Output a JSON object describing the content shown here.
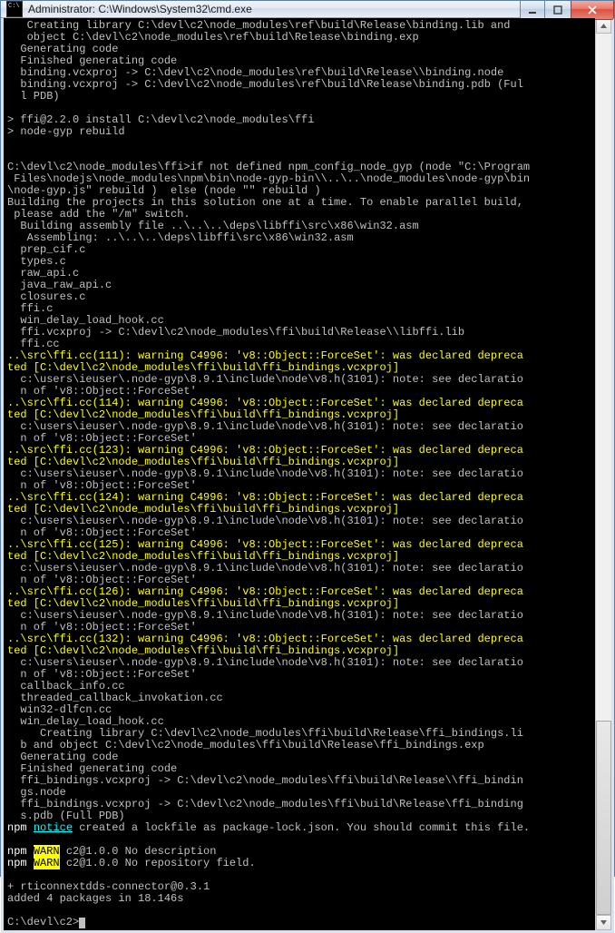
{
  "window": {
    "title": "Administrator: C:\\Windows\\System32\\cmd.exe"
  },
  "scrollbar": {
    "thumb_top_pct": 78,
    "thumb_height_pct": 22
  },
  "lines": [
    {
      "cls": "w",
      "t": "   Creating library C:\\devl\\c2\\node_modules\\ref\\build\\Release\\binding.lib and"
    },
    {
      "cls": "w",
      "t": "   object C:\\devl\\c2\\node_modules\\ref\\build\\Release\\binding.exp"
    },
    {
      "cls": "w",
      "t": "  Generating code"
    },
    {
      "cls": "w",
      "t": "  Finished generating code"
    },
    {
      "cls": "w",
      "t": "  binding.vcxproj -> C:\\devl\\c2\\node_modules\\ref\\build\\Release\\\\binding.node"
    },
    {
      "cls": "w",
      "t": "  binding.vcxproj -> C:\\devl\\c2\\node_modules\\ref\\build\\Release\\binding.pdb (Ful"
    },
    {
      "cls": "w",
      "t": "  l PDB)"
    },
    {
      "cls": "w",
      "t": ""
    },
    {
      "cls": "w",
      "t": "> ffi@2.2.0 install C:\\devl\\c2\\node_modules\\ffi"
    },
    {
      "cls": "w",
      "t": "> node-gyp rebuild"
    },
    {
      "cls": "w",
      "t": ""
    },
    {
      "cls": "w",
      "t": ""
    },
    {
      "cls": "w",
      "t": "C:\\devl\\c2\\node_modules\\ffi>if not defined npm_config_node_gyp (node \"C:\\Program"
    },
    {
      "cls": "w",
      "t": " Files\\nodejs\\node_modules\\npm\\bin\\node-gyp-bin\\\\..\\..\\node_modules\\node-gyp\\bin"
    },
    {
      "cls": "w",
      "t": "\\node-gyp.js\" rebuild )  else (node \"\" rebuild )"
    },
    {
      "cls": "w",
      "t": "Building the projects in this solution one at a time. To enable parallel build,"
    },
    {
      "cls": "w",
      "t": " please add the \"/m\" switch."
    },
    {
      "cls": "w",
      "t": "  Building assembly file ..\\..\\..\\deps\\libffi\\src\\x86\\win32.asm"
    },
    {
      "cls": "w",
      "t": "   Assembling: ..\\..\\..\\deps\\libffi\\src\\x86\\win32.asm"
    },
    {
      "cls": "w",
      "t": "  prep_cif.c"
    },
    {
      "cls": "w",
      "t": "  types.c"
    },
    {
      "cls": "w",
      "t": "  raw_api.c"
    },
    {
      "cls": "w",
      "t": "  java_raw_api.c"
    },
    {
      "cls": "w",
      "t": "  closures.c"
    },
    {
      "cls": "w",
      "t": "  ffi.c"
    },
    {
      "cls": "w",
      "t": "  win_delay_load_hook.cc"
    },
    {
      "cls": "w",
      "t": "  ffi.vcxproj -> C:\\devl\\c2\\node_modules\\ffi\\build\\Release\\\\libffi.lib"
    },
    {
      "cls": "w",
      "t": "  ffi.cc"
    },
    {
      "cls": "y",
      "t": "..\\src\\ffi.cc(111): warning C4996: 'v8::Object::ForceSet': was declared depreca"
    },
    {
      "cls": "y",
      "t": "ted [C:\\devl\\c2\\node_modules\\ffi\\build\\ffi_bindings.vcxproj]"
    },
    {
      "cls": "w",
      "t": "  c:\\users\\ieuser\\.node-gyp\\8.9.1\\include\\node\\v8.h(3101): note: see declaratio"
    },
    {
      "cls": "w",
      "t": "  n of 'v8::Object::ForceSet'"
    },
    {
      "cls": "y",
      "t": "..\\src\\ffi.cc(114): warning C4996: 'v8::Object::ForceSet': was declared depreca"
    },
    {
      "cls": "y",
      "t": "ted [C:\\devl\\c2\\node_modules\\ffi\\build\\ffi_bindings.vcxproj]"
    },
    {
      "cls": "w",
      "t": "  c:\\users\\ieuser\\.node-gyp\\8.9.1\\include\\node\\v8.h(3101): note: see declaratio"
    },
    {
      "cls": "w",
      "t": "  n of 'v8::Object::ForceSet'"
    },
    {
      "cls": "y",
      "t": "..\\src\\ffi.cc(123): warning C4996: 'v8::Object::ForceSet': was declared depreca"
    },
    {
      "cls": "y",
      "t": "ted [C:\\devl\\c2\\node_modules\\ffi\\build\\ffi_bindings.vcxproj]"
    },
    {
      "cls": "w",
      "t": "  c:\\users\\ieuser\\.node-gyp\\8.9.1\\include\\node\\v8.h(3101): note: see declaratio"
    },
    {
      "cls": "w",
      "t": "  n of 'v8::Object::ForceSet'"
    },
    {
      "cls": "y",
      "t": "..\\src\\ffi.cc(124): warning C4996: 'v8::Object::ForceSet': was declared depreca"
    },
    {
      "cls": "y",
      "t": "ted [C:\\devl\\c2\\node_modules\\ffi\\build\\ffi_bindings.vcxproj]"
    },
    {
      "cls": "w",
      "t": "  c:\\users\\ieuser\\.node-gyp\\8.9.1\\include\\node\\v8.h(3101): note: see declaratio"
    },
    {
      "cls": "w",
      "t": "  n of 'v8::Object::ForceSet'"
    },
    {
      "cls": "y",
      "t": "..\\src\\ffi.cc(125): warning C4996: 'v8::Object::ForceSet': was declared depreca"
    },
    {
      "cls": "y",
      "t": "ted [C:\\devl\\c2\\node_modules\\ffi\\build\\ffi_bindings.vcxproj]"
    },
    {
      "cls": "w",
      "t": "  c:\\users\\ieuser\\.node-gyp\\8.9.1\\include\\node\\v8.h(3101): note: see declaratio"
    },
    {
      "cls": "w",
      "t": "  n of 'v8::Object::ForceSet'"
    },
    {
      "cls": "y",
      "t": "..\\src\\ffi.cc(126): warning C4996: 'v8::Object::ForceSet': was declared depreca"
    },
    {
      "cls": "y",
      "t": "ted [C:\\devl\\c2\\node_modules\\ffi\\build\\ffi_bindings.vcxproj]"
    },
    {
      "cls": "w",
      "t": "  c:\\users\\ieuser\\.node-gyp\\8.9.1\\include\\node\\v8.h(3101): note: see declaratio"
    },
    {
      "cls": "w",
      "t": "  n of 'v8::Object::ForceSet'"
    },
    {
      "cls": "y",
      "t": "..\\src\\ffi.cc(132): warning C4996: 'v8::Object::ForceSet': was declared depreca"
    },
    {
      "cls": "y",
      "t": "ted [C:\\devl\\c2\\node_modules\\ffi\\build\\ffi_bindings.vcxproj]"
    },
    {
      "cls": "w",
      "t": "  c:\\users\\ieuser\\.node-gyp\\8.9.1\\include\\node\\v8.h(3101): note: see declaratio"
    },
    {
      "cls": "w",
      "t": "  n of 'v8::Object::ForceSet'"
    },
    {
      "cls": "w",
      "t": "  callback_info.cc"
    },
    {
      "cls": "w",
      "t": "  threaded_callback_invokation.cc"
    },
    {
      "cls": "w",
      "t": "  win32-dlfcn.cc"
    },
    {
      "cls": "w",
      "t": "  win_delay_load_hook.cc"
    },
    {
      "cls": "w",
      "t": "     Creating library C:\\devl\\c2\\node_modules\\ffi\\build\\Release\\ffi_bindings.li"
    },
    {
      "cls": "w",
      "t": "  b and object C:\\devl\\c2\\node_modules\\ffi\\build\\Release\\ffi_bindings.exp"
    },
    {
      "cls": "w",
      "t": "  Generating code"
    },
    {
      "cls": "w",
      "t": "  Finished generating code"
    },
    {
      "cls": "w",
      "t": "  ffi_bindings.vcxproj -> C:\\devl\\c2\\node_modules\\ffi\\build\\Release\\\\ffi_bindin"
    },
    {
      "cls": "w",
      "t": "  gs.node"
    },
    {
      "cls": "w",
      "t": "  ffi_bindings.vcxproj -> C:\\devl\\c2\\node_modules\\ffi\\build\\Release\\ffi_binding"
    },
    {
      "cls": "w",
      "t": "  s.pdb (Full PDB)"
    }
  ],
  "npm_notice_line": {
    "prefix": "npm ",
    "tag": "notice",
    "text": " created a lockfile as package-lock.json. You should commit this file."
  },
  "npm_warn_lines": [
    {
      "prefix": "npm ",
      "tag": "WARN",
      "text": " c2@1.0.0 No description"
    },
    {
      "prefix": "npm ",
      "tag": "WARN",
      "text": " c2@1.0.0 No repository field."
    }
  ],
  "footer_lines": [
    "",
    "+ rticonnextdds-connector@0.3.1",
    "added 4 packages in 18.146s",
    ""
  ],
  "prompt": "C:\\devl\\c2>"
}
